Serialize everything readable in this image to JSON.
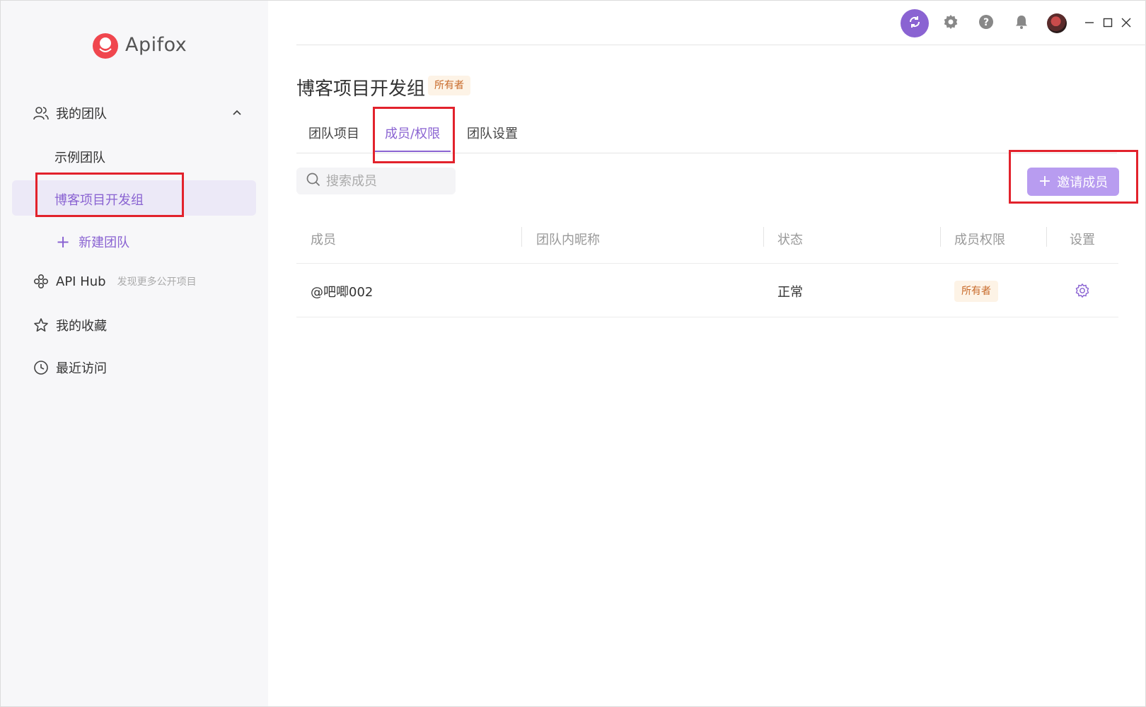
{
  "app": {
    "name": "Apifox"
  },
  "sidebar": {
    "my_team": "我的团队",
    "teams": [
      {
        "label": "示例团队"
      },
      {
        "label": "博客项目开发组"
      }
    ],
    "new_team": "新建团队",
    "api_hub": {
      "label": "API Hub",
      "sub": "发现更多公开项目"
    },
    "favorites": "我的收藏",
    "recent": "最近访问"
  },
  "header": {
    "title": "博客项目开发组",
    "badge": "所有者"
  },
  "tabs": [
    {
      "label": "团队项目"
    },
    {
      "label": "成员/权限",
      "active": true
    },
    {
      "label": "团队设置"
    }
  ],
  "search": {
    "placeholder": "搜索成员"
  },
  "invite_button": "邀请成员",
  "table": {
    "columns": [
      "成员",
      "团队内昵称",
      "状态",
      "成员权限",
      "设置"
    ],
    "rows": [
      {
        "member": "@吧唧002",
        "nickname": "",
        "status": "正常",
        "role": "所有者"
      }
    ]
  },
  "colors": {
    "accent": "#8a63d2",
    "accent_light": "#b89cf0",
    "highlight": "#e2222c",
    "badge_bg": "#fdf3e6",
    "badge_text": "#c86a2a"
  },
  "icons": [
    "sync-icon",
    "settings-icon",
    "help-icon",
    "bell-icon",
    "avatar",
    "minimize-icon",
    "maximize-icon",
    "close-icon"
  ]
}
